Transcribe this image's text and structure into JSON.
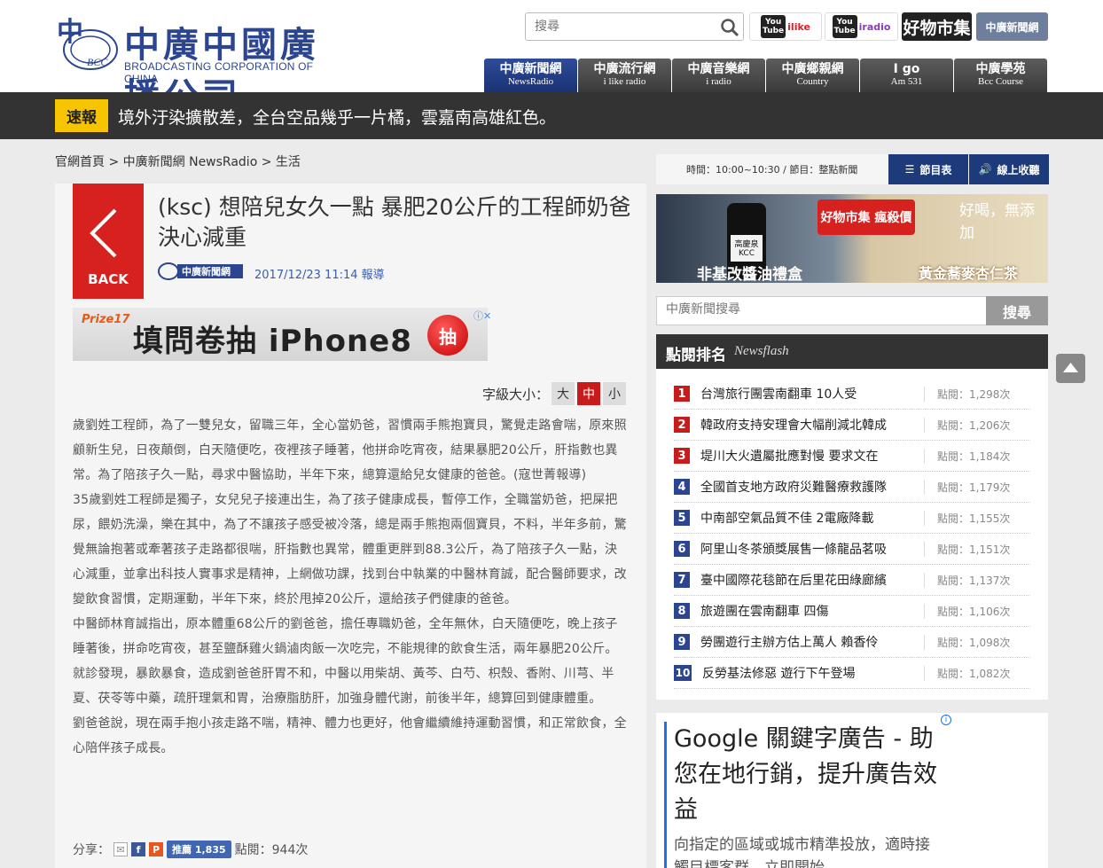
{
  "header": {
    "logo_cn": "中廣中國廣播公司",
    "logo_en": "BROADCASTING CORPORATION OF CHINA",
    "logo_badge": "BCC",
    "search_placeholder": "搜尋",
    "partners": [
      {
        "label": "ilike",
        "icon": "youtube-icon"
      },
      {
        "label": "iradio",
        "icon": "youtube-icon"
      },
      {
        "label": "好物市集"
      },
      {
        "label": "中廣新聞網"
      }
    ],
    "nav": [
      {
        "cn": "中廣新聞網",
        "en": "NewsRadio",
        "active": true
      },
      {
        "cn": "中廣流行網",
        "en": "i like radio"
      },
      {
        "cn": "中廣音樂網",
        "en": "i radio"
      },
      {
        "cn": "中廣鄉親網",
        "en": "Country"
      },
      {
        "cn": "I go",
        "en": "Am 531"
      },
      {
        "cn": "中廣學苑",
        "en": "Bcc Course"
      }
    ]
  },
  "flash": {
    "tag": "速報",
    "text": "境外汙染擴散差，全台空品幾乎一片橘，雲嘉南高雄紅色。"
  },
  "breadcrumb": [
    "官網首頁",
    "中廣新聞網 NewsRadio",
    "生活"
  ],
  "breadcrumb_sep": ">",
  "article": {
    "back_label": "BACK",
    "title": "(ksc) 想陪兒女久一點 暴肥20公斤的工程師奶爸決心減重",
    "source_logo": "中廣新聞網",
    "date": "2017/12/23 11:14 報導",
    "ad": {
      "brand": "Prize17",
      "text": "填問卷抽 iPhone8",
      "button": "抽"
    },
    "font_size_label": "字級大小：",
    "font_sizes": [
      "大",
      "中",
      "小"
    ],
    "font_size_selected": "中",
    "paragraphs": [
      "歲劉姓工程師，為了一雙兒女，留職三年，全心當奶爸，習慣兩手熊抱寶貝，驚覺走路會喘，原來照顧新生兒，日夜顛倒，白天隨便吃，夜裡孩子睡著，他拼命吃宵夜，結果暴肥20公斤，肝指數也異常。為了陪孩子久一點，尋求中醫協助，半年下來，總算還給兒女健康的爸爸。(寇世菁報導)",
      "35歲劉姓工程師是獨子，女兒兒子接連出生，為了孩子健康成長，暫停工作，全職當奶爸，把屎把尿，餵奶洗澡，樂在其中，為了不讓孩子感受被冷落，總是兩手熊抱兩個寶貝，不料，半年多前，驚覺無論抱著或牽著孩子走路都很喘，肝指數也異常，體重更胖到88.3公斤，為了陪孩子久一點，決心減重，並拿出科技人實事求是精神，上網做功課，找到台中執業的中醫林育誠，配合醫師要求，改變飲食習慣，定期運動，半年下來，終於甩掉20公斤，還給孩子們健康的爸爸。",
      "中醫師林育誠指出，原本體重68公斤的劉爸爸，擔任專職奶爸，全年無休，白天隨便吃，晚上孩子睡著後，拼命吃宵夜，甚至鹽酥雞火鍋滷肉飯一次吃完，不能規律的飲食生活，兩年暴肥20公斤。就診發現，暴飲暴食，造成劉爸爸肝胃不和，中醫以用柴胡、黃芩、白芍、枳殼、香附、川芎、半夏、茯苓等中藥，疏肝理氣和胃，治療脂肪肝，加強身體代謝，前後半年，總算回到健康體重。",
      "劉爸爸說，現在兩手抱小孩走路不喘，精神、體力也更好，他會繼續維持運動習慣，和正常飲食，全心陪伴孩子成長。"
    ],
    "share_label": "分享：",
    "fb_like": "推薦 1,835",
    "views": "點閱：944次"
  },
  "sidebar": {
    "program": "時間：10:00~10:30 / 節目：整點新聞",
    "schedule_btn": "節目表",
    "listen_btn": "線上收聽",
    "ad": {
      "bottle_label": "高慶泉 KCC",
      "left_text": "非基改醬油禮盒",
      "badge": "好物市集 瘋殺價",
      "right_text": "黃金蕎麥杏仁茶",
      "tagline": "好喝，無添加"
    },
    "search_placeholder": "中廣新聞搜尋",
    "search_btn": "搜尋",
    "rank_title": "點閱排名",
    "rank_sub": "Newsflash",
    "rank": [
      {
        "n": "1",
        "title": "台灣旅行團雲南翻車 10人受",
        "views": "點閱：1,298次"
      },
      {
        "n": "2",
        "title": "韓政府支持安理會大幅削減北韓成",
        "views": "點閱：1,206次"
      },
      {
        "n": "3",
        "title": "堤川大火遺屬批應對慢 要求文在",
        "views": "點閱：1,184次"
      },
      {
        "n": "4",
        "title": "全國首支地方政府災難醫療救護隊",
        "views": "點閱：1,179次"
      },
      {
        "n": "5",
        "title": "中南部空氣品質不佳 2電廠降載",
        "views": "點閱：1,155次"
      },
      {
        "n": "6",
        "title": "阿里山冬茶頒獎展售一條龍品茗吸",
        "views": "點閱：1,151次"
      },
      {
        "n": "7",
        "title": "臺中國際花毯節在后里花田綠廊繽",
        "views": "點閱：1,137次"
      },
      {
        "n": "8",
        "title": "旅遊團在雲南翻車 四傷",
        "views": "點閱：1,106次"
      },
      {
        "n": "9",
        "title": "勞團遊行主辦方估上萬人 賴香伶",
        "views": "點閱：1,098次"
      },
      {
        "n": "10",
        "title": "反勞基法修惡 遊行下午登場",
        "views": "點閱：1,082次"
      }
    ],
    "google_ad": {
      "headline": "Google 關鍵字廣告 - 助您在地行銷，提升廣告效益",
      "sub": "向指定的區域或城市精準投放，適時接觸目標客群，立即開始。"
    }
  },
  "colors": {
    "brand_blue": "#2b4590",
    "accent_red": "#d7211e",
    "flash_yellow": "#f7c400"
  }
}
